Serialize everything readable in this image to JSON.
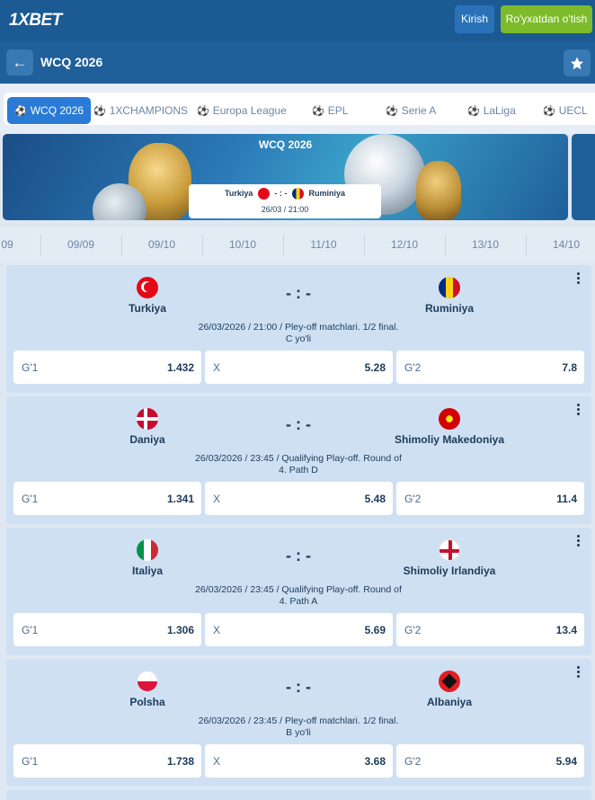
{
  "app": {
    "logo": "1XBET",
    "login": "Kirish",
    "register": "Ro'yxatdan o'tish"
  },
  "page": {
    "title": "WCQ 2026"
  },
  "tabs": [
    {
      "label": "WCQ 2026"
    },
    {
      "label": "1XCHAMPIONS"
    },
    {
      "label": "Europa League"
    },
    {
      "label": "EPL"
    },
    {
      "label": "Serie A"
    },
    {
      "label": "LaLiga"
    },
    {
      "label": "UECL"
    }
  ],
  "banner": {
    "title": "WCQ 2026",
    "home": "Turkiya",
    "away": "Ruminiya",
    "score": "- : -",
    "date": "26/03 / 21:00"
  },
  "dates": [
    "09",
    "09/09",
    "09/10",
    "10/10",
    "11/10",
    "12/10",
    "13/10",
    "14/10"
  ],
  "matches": [
    {
      "home": "Turkiya",
      "away": "Ruminiya",
      "score": "- : -",
      "info1": "26/03/2026 / 21:00 / Pley-off matchlari. 1/2 final.",
      "info2": "C yo'li",
      "odds": [
        {
          "label": "G'1",
          "value": "1.432"
        },
        {
          "label": "X",
          "value": "5.28"
        },
        {
          "label": "G'2",
          "value": "7.8"
        }
      ]
    },
    {
      "home": "Daniya",
      "away": "Shimoliy Makedoniya",
      "score": "- : -",
      "info1": "26/03/2026 / 23:45 / Qualifying Play-off. Round of",
      "info2": "4. Path D",
      "odds": [
        {
          "label": "G'1",
          "value": "1.341"
        },
        {
          "label": "X",
          "value": "5.48"
        },
        {
          "label": "G'2",
          "value": "11.4"
        }
      ]
    },
    {
      "home": "Italiya",
      "away": "Shimoliy Irlandiya",
      "score": "- : -",
      "info1": "26/03/2026 / 23:45 / Qualifying Play-off. Round of",
      "info2": "4. Path A",
      "odds": [
        {
          "label": "G'1",
          "value": "1.306"
        },
        {
          "label": "X",
          "value": "5.69"
        },
        {
          "label": "G'2",
          "value": "13.4"
        }
      ]
    },
    {
      "home": "Polsha",
      "away": "Albaniya",
      "score": "- : -",
      "info1": "26/03/2026 / 23:45 / Pley-off matchlari. 1/2 final.",
      "info2": "B yo'li",
      "odds": [
        {
          "label": "G'1",
          "value": "1.738"
        },
        {
          "label": "X",
          "value": "3.68"
        },
        {
          "label": "G'2",
          "value": "5.94"
        }
      ]
    }
  ],
  "colors": {
    "topbar": "#1c5a93",
    "accent": "#2a7bd6",
    "register": "#7dbb2b",
    "card": "#cfe0f3"
  }
}
